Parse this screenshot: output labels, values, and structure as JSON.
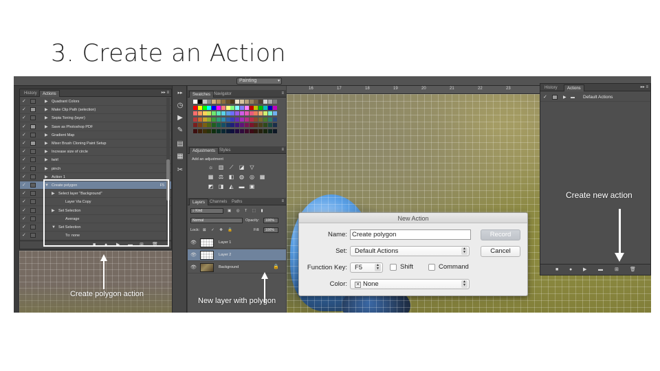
{
  "slide": {
    "title": "3. Create an Action"
  },
  "workspace": {
    "label": "Painting"
  },
  "actions_panel_left": {
    "tabs": [
      "History",
      "Actions"
    ],
    "items": [
      {
        "label": "Quadrant Colors",
        "dialog": false
      },
      {
        "label": "Make Clip Path (selection)",
        "dialog": true
      },
      {
        "label": "Sepia Toning (layer)",
        "dialog": false
      },
      {
        "label": "Save as Photoshop PDF",
        "dialog": true
      },
      {
        "label": "Gradient Map",
        "dialog": false
      },
      {
        "label": "Mixer Brush Cloning Paint Setup",
        "dialog": true
      },
      {
        "label": "Increase size of circle",
        "dialog": false
      },
      {
        "label": "twirl",
        "dialog": false
      },
      {
        "label": "pinch",
        "dialog": false
      },
      {
        "label": "Action 1",
        "dialog": false
      }
    ],
    "selected": {
      "label": "Create polygon",
      "key": "F5"
    },
    "steps": [
      {
        "label": "Select layer \"Background\"",
        "twist": "▶"
      },
      {
        "label": "Layer Via Copy",
        "twist": ""
      },
      {
        "label": "Set Selection",
        "twist": "▶"
      },
      {
        "label": "Average",
        "twist": ""
      },
      {
        "label": "Set Selection",
        "twist": "▼"
      },
      {
        "label": "To: none",
        "twist": ""
      }
    ]
  },
  "swatches": {
    "tabs": [
      "Swatches",
      "Navigator"
    ]
  },
  "adjustments": {
    "tabs": [
      "Adjustments",
      "Styles"
    ],
    "title": "Add an adjustment"
  },
  "layers_panel": {
    "tabs": [
      "Layers",
      "Channels",
      "Paths"
    ],
    "kind": "Kind",
    "blend_mode": "Normal",
    "opacity_label": "Opacity:",
    "opacity": "100%",
    "lock_label": "Lock:",
    "fill_label": "Fill:",
    "fill": "100%",
    "layers": [
      {
        "name": "Layer 1",
        "selected": false
      },
      {
        "name": "Layer 2",
        "selected": true
      },
      {
        "name": "Background",
        "selected": false
      }
    ]
  },
  "ruler": {
    "ticks": [
      "16",
      "17",
      "18",
      "19",
      "20",
      "21",
      "22",
      "23"
    ]
  },
  "actions_panel_right": {
    "tabs": [
      "History",
      "Actions"
    ],
    "set": "Default Actions"
  },
  "dialog": {
    "title": "New Action",
    "name_label": "Name:",
    "name_value": "Create polygon",
    "set_label": "Set:",
    "set_value": "Default Actions",
    "function_key_label": "Function Key:",
    "function_key_value": "F5",
    "shift_label": "Shift",
    "command_label": "Command",
    "color_label": "Color:",
    "color_value": "None",
    "record_label": "Record",
    "cancel_label": "Cancel"
  },
  "annotations": {
    "create_new_action": "Create new action",
    "create_polygon_action": "Create polygon action",
    "new_layer_with_polygon": "New layer with polygon"
  }
}
